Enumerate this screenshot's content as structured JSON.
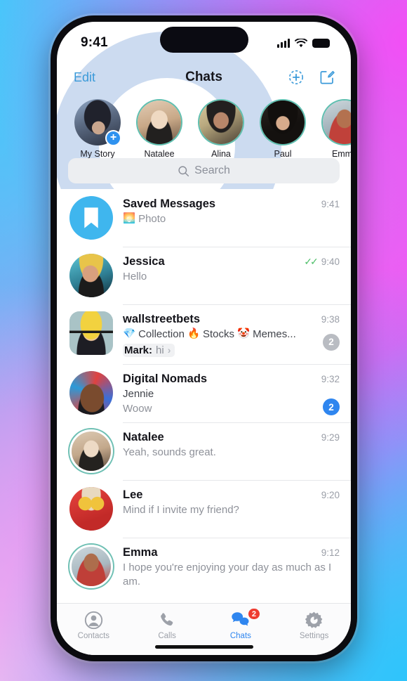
{
  "status_bar": {
    "time": "9:41",
    "signal_icon": "cellular-bars-icon",
    "wifi_icon": "wifi-icon",
    "battery_icon": "battery-icon"
  },
  "nav": {
    "edit_label": "Edit",
    "title": "Chats",
    "add_story_icon": "add-story-icon",
    "compose_icon": "compose-icon"
  },
  "stories": [
    {
      "name": "My Story",
      "has_ring": false,
      "has_plus": true
    },
    {
      "name": "Natalee",
      "has_ring": true,
      "has_plus": false
    },
    {
      "name": "Alina",
      "has_ring": true,
      "has_plus": false
    },
    {
      "name": "Paul",
      "has_ring": true,
      "has_plus": false
    },
    {
      "name": "Emma",
      "has_ring": true,
      "has_plus": false
    }
  ],
  "search": {
    "placeholder": "Search",
    "icon": "search-icon"
  },
  "chats": [
    {
      "name": "Saved Messages",
      "time": "9:41",
      "message": "Photo",
      "message_emoji": "🌅",
      "avatar_type": "saved-bookmark",
      "badge": null,
      "ticks": false
    },
    {
      "name": "Jessica",
      "time": "9:40",
      "message": "Hello",
      "avatar_type": "photo",
      "badge": null,
      "ticks": true
    },
    {
      "name": "wallstreetbets",
      "time": "9:38",
      "tags": [
        {
          "emoji": "💎",
          "text": "Collection"
        },
        {
          "emoji": "🔥",
          "text": "Stocks"
        },
        {
          "emoji": "🤡",
          "text": "Memes..."
        }
      ],
      "reply_author": "Mark:",
      "reply_text": "hi",
      "avatar_type": "square-photo",
      "badge": {
        "count": "2",
        "style": "muted"
      },
      "ticks": false
    },
    {
      "name": "Digital Nomads",
      "time": "9:32",
      "sender": "Jennie",
      "message": "Woow",
      "avatar_type": "photo",
      "badge": {
        "count": "2",
        "style": "unread"
      },
      "ticks": false
    },
    {
      "name": "Natalee",
      "time": "9:29",
      "message": "Yeah, sounds great.",
      "avatar_type": "photo-ringed",
      "badge": null,
      "ticks": false
    },
    {
      "name": "Lee",
      "time": "9:20",
      "message": "Mind if I invite my friend?",
      "avatar_type": "photo",
      "badge": null,
      "ticks": false
    },
    {
      "name": "Emma",
      "time": "9:12",
      "message": "I hope you're enjoying your day as much as I am.",
      "avatar_type": "photo-ringed",
      "badge": null,
      "ticks": false
    }
  ],
  "tabs": [
    {
      "label": "Contacts",
      "icon": "contacts-icon",
      "active": false,
      "badge": null
    },
    {
      "label": "Calls",
      "icon": "phone-icon",
      "active": false,
      "badge": null
    },
    {
      "label": "Chats",
      "icon": "chats-bubbles-icon",
      "active": true,
      "badge": "2"
    },
    {
      "label": "Settings",
      "icon": "gear-icon",
      "active": false,
      "badge": null
    }
  ],
  "colors": {
    "accent_blue": "#2f86ef",
    "nav_link": "#3b9ad9",
    "story_ring": "#5fbfb0",
    "badge_muted": "#b9bcc2",
    "badge_red": "#ee3b30",
    "tick_green": "#4fbf6a"
  }
}
